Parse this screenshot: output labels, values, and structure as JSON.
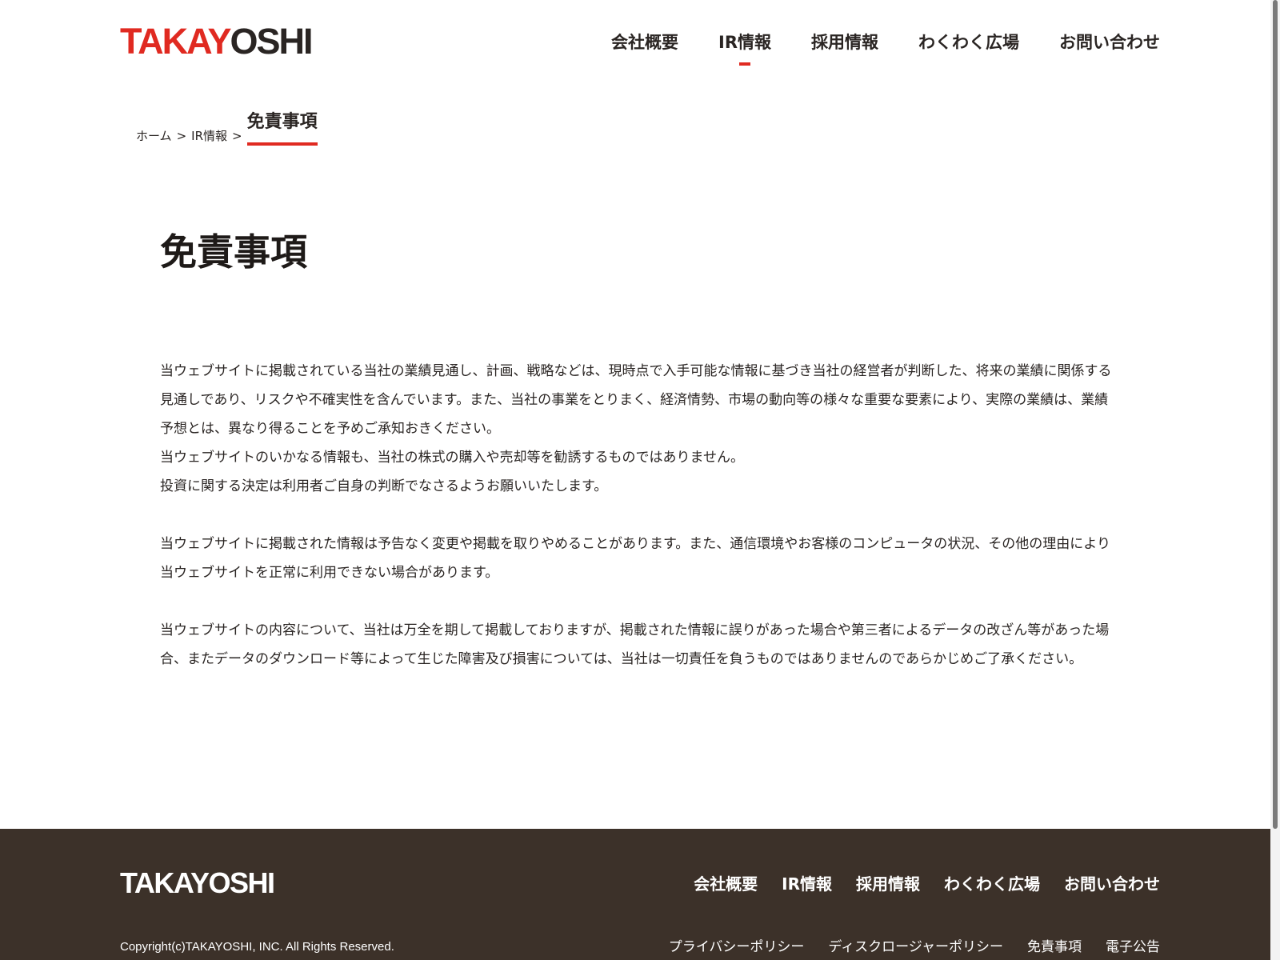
{
  "header": {
    "logo_part1": "TAKAY",
    "logo_part2": "OSHI",
    "nav": [
      {
        "label": "会社概要"
      },
      {
        "label": "IR情報"
      },
      {
        "label": "採用情報"
      },
      {
        "label": "わくわく広場"
      },
      {
        "label": "お問い合わせ"
      }
    ],
    "active_nav": "IR情報"
  },
  "breadcrumb": {
    "home": "ホーム",
    "separator": ">",
    "parent": "IR情報",
    "current": "免責事項"
  },
  "main": {
    "title": "免責事項",
    "paragraphs": [
      {
        "lines": [
          "当ウェブサイトに掲載されている当社の業績見通し、計画、戦略などは、現時点で入手可能な情報に基づき当社の経営者が判断した、将来の業績に関係する見通しであり、リスクや不確実性を含んでいます。また、当社の事業をとりまく、経済情勢、市場の動向等の様々な重要な要素により、実際の業績は、業績予想とは、異なり得ることを予めご承知おきください。",
          "当ウェブサイトのいかなる情報も、当社の株式の購入や売却等を勧誘するものではありません。",
          "投資に関する決定は利用者ご自身の判断でなさるようお願いいたします。"
        ]
      },
      {
        "lines": [
          "当ウェブサイトに掲載された情報は予告なく変更や掲載を取りやめることがあります。また、通信環境やお客様のコンピュータの状況、その他の理由により当ウェブサイトを正常に利用できない場合があります。"
        ]
      },
      {
        "lines": [
          "当ウェブサイトの内容について、当社は万全を期して掲載しておりますが、掲載された情報に誤りがあった場合や第三者によるデータの改ざん等があった場合、またデータのダウンロード等によって生じた障害及び損害については、当社は一切責任を負うものではありませんのであらかじめご了承ください。"
        ]
      }
    ]
  },
  "footer": {
    "logo": "TAKAYOSHI",
    "nav": [
      {
        "label": "会社概要"
      },
      {
        "label": "IR情報"
      },
      {
        "label": "採用情報"
      },
      {
        "label": "わくわく広場"
      },
      {
        "label": "お問い合わせ"
      }
    ],
    "copyright": "Copyright(c)TAKAYOSHI, INC. All Rights Reserved.",
    "sub_links": [
      {
        "label": "プライバシーポリシー"
      },
      {
        "label": "ディスクロージャーポリシー"
      },
      {
        "label": "免責事項"
      },
      {
        "label": "電子公告"
      }
    ]
  },
  "colors": {
    "brand_red": "#e02a21",
    "text_dark": "#2a2523",
    "footer_bg": "#3c3129",
    "white": "#ffffff"
  }
}
